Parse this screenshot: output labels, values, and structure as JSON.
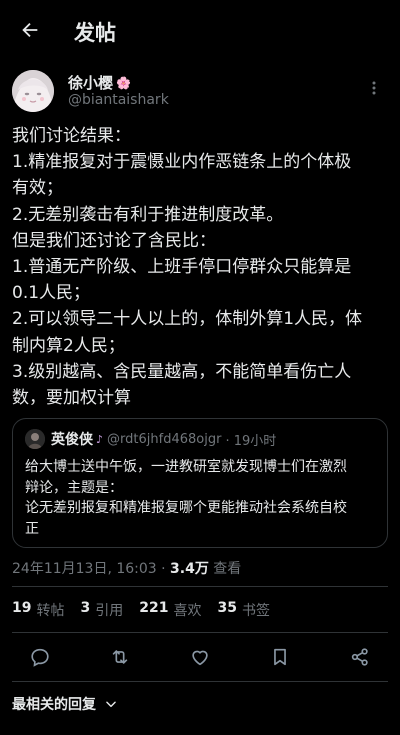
{
  "header": {
    "title": "发帖",
    "back_icon": "arrow-left-icon"
  },
  "author": {
    "name": "徐小樱",
    "name_emoji": "🌸",
    "handle": "@biantaishark"
  },
  "post": {
    "lines": [
      "我们讨论结果：",
      "1.精准报复对于震慑业内作恶链条上的个体极",
      "有效；",
      "2.无差别袭击有利于推进制度改革。",
      "但是我们还讨论了含民比：",
      "1.普通无产阶级、上班手停口停群众只能算是",
      "0.1人民；",
      "2.可以领导二十人以上的，体制外算1人民，体",
      "制内算2人民；",
      "3.级别越高、含民量越高，不能简单看伤亡人",
      "数，要加权计算"
    ]
  },
  "quote": {
    "name": "英俊侠",
    "handle": "@rdt6jhfd468ojgr",
    "time": "· 19小时",
    "lines": [
      "给大博士送中午饭，一进教研室就发现博士们在激烈",
      "辩论，主题是：",
      "论无差别报复和精准报复哪个更能推动社会系统自校",
      "正"
    ]
  },
  "meta": {
    "datetime": "24年11月13日, 16:03 · ",
    "views": "3.4万",
    "views_label": " 查看"
  },
  "stats": {
    "reposts": "19",
    "reposts_label": "转帖",
    "quotes": "3",
    "quotes_label": "引用",
    "likes": "221",
    "likes_label": "喜欢",
    "bookmarks": "35",
    "bookmarks_label": "书签"
  },
  "relevant_replies": {
    "label": "最相关的回复"
  },
  "colors": {
    "background": "#000000",
    "text": "#e7e9ea",
    "muted": "#71767b",
    "border": "#2f3336"
  }
}
